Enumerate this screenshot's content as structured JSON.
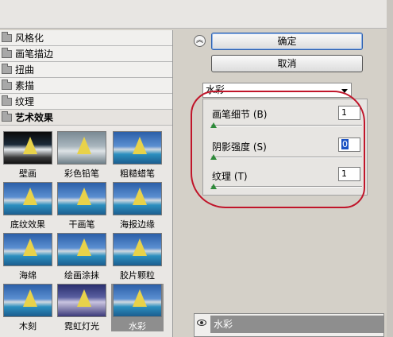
{
  "categories": [
    "风格化",
    "画笔描边",
    "扭曲",
    "素描",
    "纹理",
    "艺术效果"
  ],
  "thumbnails": [
    {
      "label": "壁画",
      "variant": "dark"
    },
    {
      "label": "彩色铅笔",
      "variant": "gray"
    },
    {
      "label": "粗糙蜡笔",
      "variant": "normal"
    },
    {
      "label": "底纹效果",
      "variant": "normal"
    },
    {
      "label": "干画笔",
      "variant": "normal"
    },
    {
      "label": "海报边缘",
      "variant": "normal"
    },
    {
      "label": "海绵",
      "variant": "normal"
    },
    {
      "label": "绘画涂抹",
      "variant": "normal"
    },
    {
      "label": "胶片颗粒",
      "variant": "normal"
    },
    {
      "label": "木刻",
      "variant": "normal"
    },
    {
      "label": "霓虹灯光",
      "variant": "purple"
    },
    {
      "label": "水彩",
      "variant": "selected"
    }
  ],
  "buttons": {
    "ok": "确定",
    "cancel": "取消"
  },
  "filter_select": {
    "value": "水彩"
  },
  "params": [
    {
      "label": "画笔细节 (B)",
      "value": "1"
    },
    {
      "label": "阴影强度 (S)",
      "value": "0"
    },
    {
      "label": "纹理 (T)",
      "value": "1"
    }
  ],
  "layer": {
    "name": "水彩"
  },
  "colors": {
    "annotation": "#c0152a",
    "slider_thumb": "#2e8a3a",
    "selected_thumb": "#8e8e8e"
  }
}
